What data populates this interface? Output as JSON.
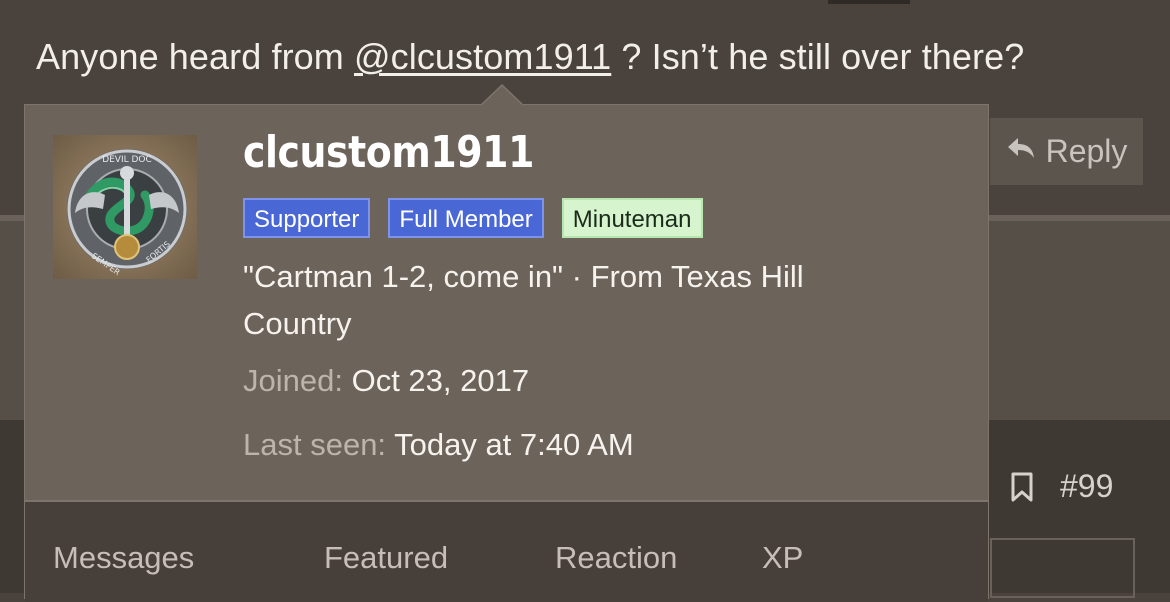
{
  "post": {
    "text_before": "Anyone heard from ",
    "mention": "@clcustom1911",
    "text_after": " ? Isn’t he still over there?",
    "reply_label": "Reply",
    "post_number": "#99"
  },
  "popup": {
    "username": "clcustom1911",
    "avatar_text_top": "DEVIL DOC",
    "avatar_text_bottom_left": "SEMPER",
    "avatar_text_bottom_right": "FORTIS",
    "badges": [
      {
        "label": "Supporter",
        "color": "#4a67d6"
      },
      {
        "label": "Full Member",
        "color": "#4a67d6"
      },
      {
        "label": "Minuteman",
        "color": "#d6f5cf"
      }
    ],
    "tagline": "\"Cartman 1-2, come in\" · From Texas Hill Country",
    "joined_label": "Joined:",
    "joined_value": "Oct 23, 2017",
    "last_seen_label": "Last seen:",
    "last_seen_value": "Today at 7:40 AM",
    "stats": [
      "Messages",
      "Featured",
      "Reaction",
      "XP"
    ]
  },
  "icons": {
    "reply": "reply-arrow-icon",
    "bookmark": "bookmark-icon"
  }
}
